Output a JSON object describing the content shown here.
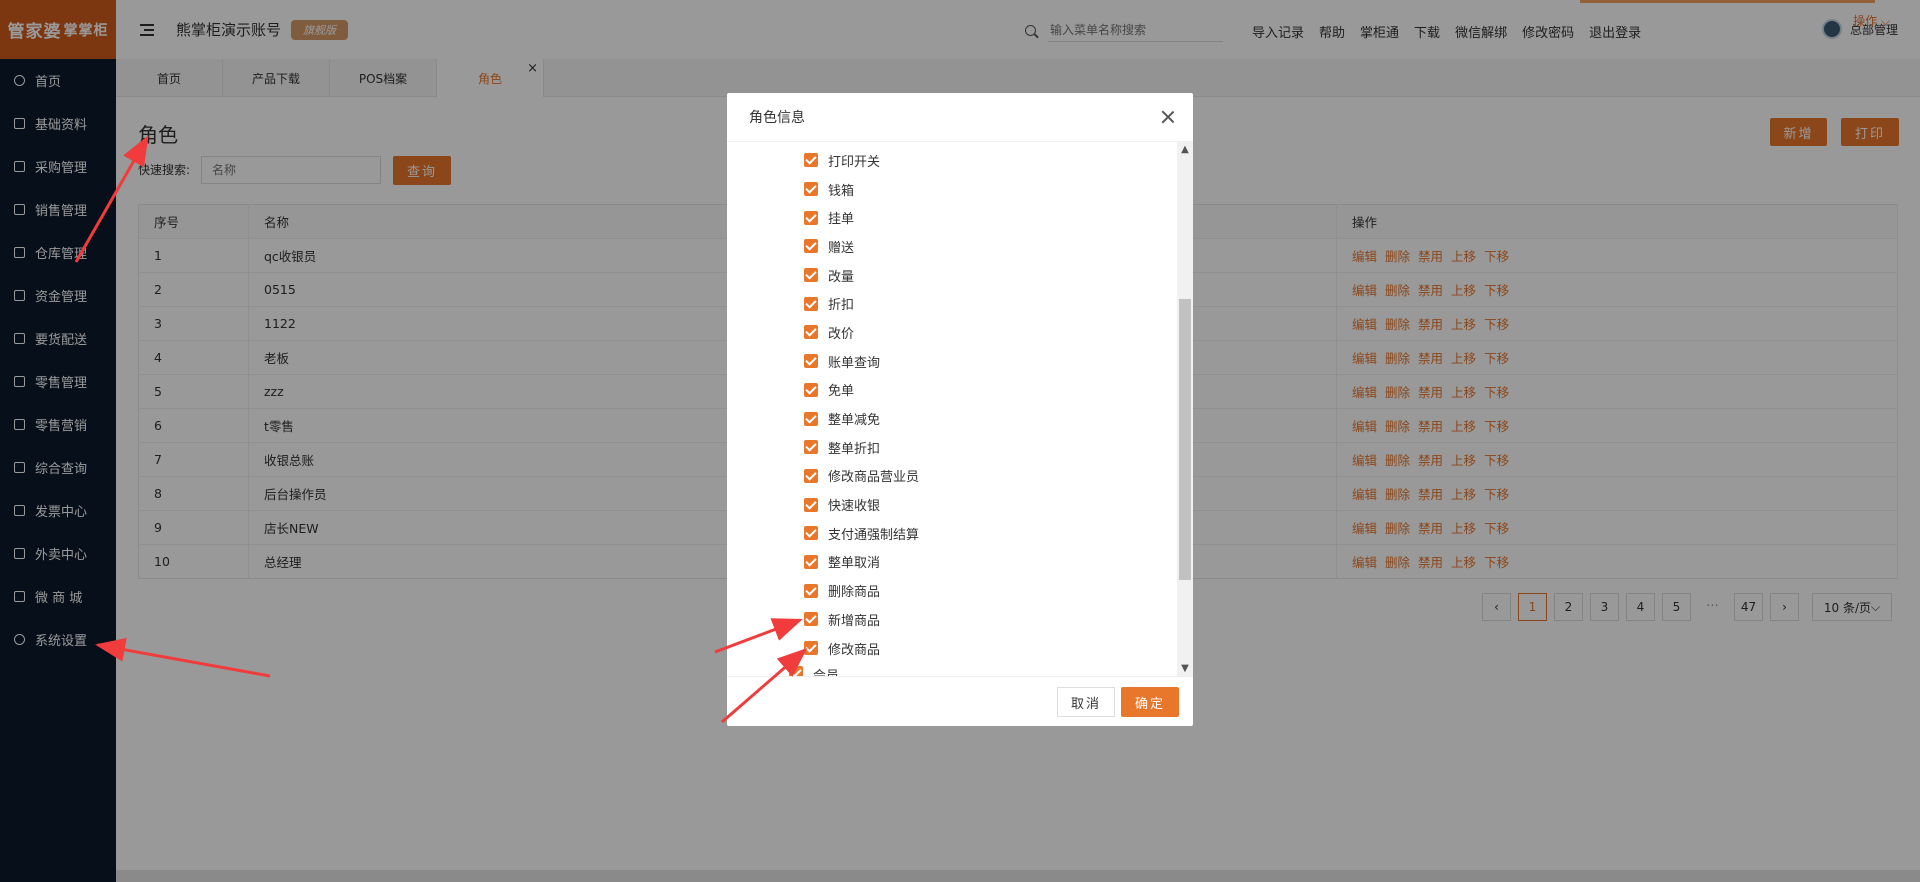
{
  "app": {
    "logo_main": "管家婆",
    "logo_sub": "掌掌柜",
    "account_title": "熊掌柜演示账号",
    "edition_badge": "旗舰版",
    "accent_color": "#e8762b"
  },
  "sidebar": {
    "items": [
      {
        "label": "首页",
        "icon": "globe-icon"
      },
      {
        "label": "基础资料",
        "icon": "home-icon"
      },
      {
        "label": "采购管理",
        "icon": "cart-icon"
      },
      {
        "label": "销售管理",
        "icon": "card-icon"
      },
      {
        "label": "仓库管理",
        "icon": "warehouse-icon"
      },
      {
        "label": "资金管理",
        "icon": "wallet-icon"
      },
      {
        "label": "要货配送",
        "icon": "list-icon"
      },
      {
        "label": "零售管理",
        "icon": "chart-icon"
      },
      {
        "label": "零售营销",
        "icon": "gift-icon"
      },
      {
        "label": "综合查询",
        "icon": "bar-chart-icon"
      },
      {
        "label": "发票中心",
        "icon": "invoice-icon"
      },
      {
        "label": "外卖中心",
        "icon": "delivery-icon"
      },
      {
        "label": "微 商 城",
        "icon": "shop-icon"
      },
      {
        "label": "系统设置",
        "icon": "gear-icon"
      }
    ]
  },
  "header": {
    "search_placeholder": "输入菜单名称搜索",
    "links": [
      "导入记录",
      "帮助",
      "掌柜通",
      "下载",
      "微信解绑",
      "修改密码",
      "退出登录"
    ],
    "user_name": "总部管理"
  },
  "tabs": {
    "items": [
      "首页",
      "产品下载",
      "POS档案",
      "角色"
    ],
    "active_index": 3,
    "ops_label": "操作"
  },
  "page": {
    "title": "角色",
    "new_button": "新增",
    "print_button": "打印",
    "quick_search_label": "快速搜索:",
    "quick_search_placeholder": "名称",
    "query_button": "查询"
  },
  "table": {
    "headers": [
      "序号",
      "名称",
      "操作"
    ],
    "rows": [
      {
        "no": "1",
        "name": "qc收银员"
      },
      {
        "no": "2",
        "name": "0515"
      },
      {
        "no": "3",
        "name": "1122"
      },
      {
        "no": "4",
        "name": "老板"
      },
      {
        "no": "5",
        "name": "zzz"
      },
      {
        "no": "6",
        "name": "t零售"
      },
      {
        "no": "7",
        "name": "收银总账"
      },
      {
        "no": "8",
        "name": "后台操作员"
      },
      {
        "no": "9",
        "name": "店长NEW"
      },
      {
        "no": "10",
        "name": "总经理"
      }
    ],
    "row_actions": [
      "编辑",
      "删除",
      "禁用",
      "上移",
      "下移"
    ]
  },
  "pagination": {
    "prev": "‹",
    "pages": [
      "1",
      "2",
      "3",
      "4",
      "5"
    ],
    "ellipsis": "···",
    "last": "47",
    "next": "›",
    "current": "1",
    "page_size": "10 条/页"
  },
  "dialog": {
    "title": "角色信息",
    "permissions": [
      {
        "label": "打印开关",
        "checked": true
      },
      {
        "label": "钱箱",
        "checked": true
      },
      {
        "label": "挂单",
        "checked": true
      },
      {
        "label": "赠送",
        "checked": true
      },
      {
        "label": "改量",
        "checked": true
      },
      {
        "label": "折扣",
        "checked": true
      },
      {
        "label": "改价",
        "checked": true
      },
      {
        "label": "账单查询",
        "checked": true
      },
      {
        "label": "免单",
        "checked": true
      },
      {
        "label": "整单减免",
        "checked": true
      },
      {
        "label": "整单折扣",
        "checked": true
      },
      {
        "label": "修改商品营业员",
        "checked": true
      },
      {
        "label": "快速收银",
        "checked": true
      },
      {
        "label": "支付通强制结算",
        "checked": true
      },
      {
        "label": "整单取消",
        "checked": true
      },
      {
        "label": "删除商品",
        "checked": true
      },
      {
        "label": "新增商品",
        "checked": true
      },
      {
        "label": "修改商品",
        "checked": true
      }
    ],
    "partial_parent": "会员",
    "cancel_button": "取消",
    "confirm_button": "确定"
  }
}
